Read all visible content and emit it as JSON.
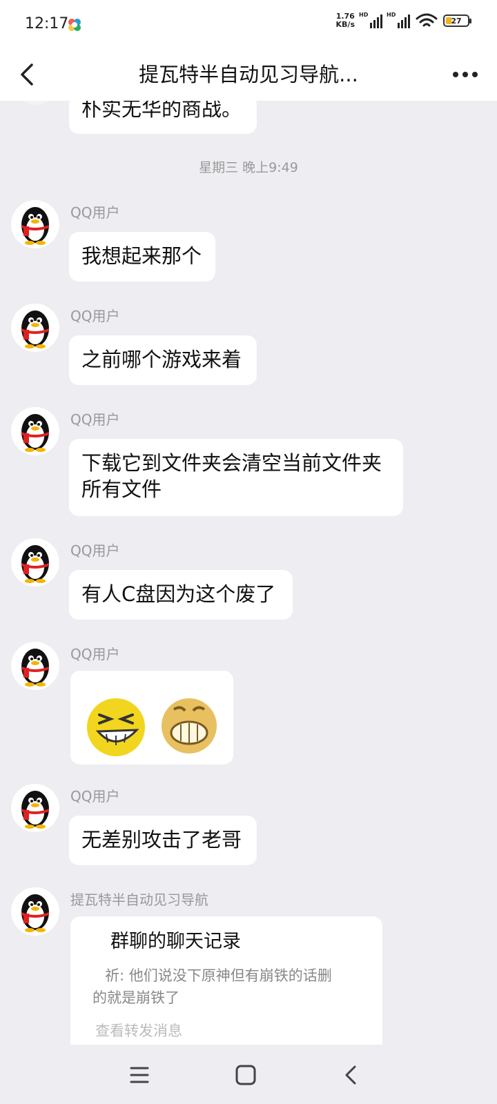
{
  "status_bar": {
    "time": "12:17",
    "net_speed_value": "1.76",
    "net_speed_unit": "KB/s",
    "signal_label_1": "HD",
    "signal_label_2": "HD",
    "battery": "27",
    "battery_level_percent": 27
  },
  "header": {
    "title": "提瓦特半自动见习导航..."
  },
  "chat": {
    "partial_message": "朴实无华的商战。",
    "time_divider": "星期三 晚上9:49",
    "messages": [
      {
        "sender": "QQ用户",
        "text": "我想起来那个"
      },
      {
        "sender": "QQ用户",
        "text": "之前哪个游戏来着"
      },
      {
        "sender": "QQ用户",
        "line1": "下载它到文件夹会清空当前文件夹",
        "line2": "所有文件"
      },
      {
        "sender": "QQ用户",
        "text": "有人C盘因为这个废了"
      },
      {
        "sender": "QQ用户",
        "stickers": [
          "laughing-face-emoji",
          "grinning-face-emoji"
        ]
      },
      {
        "sender": "QQ用户",
        "text": "无差别攻击了老哥"
      },
      {
        "sender": "提瓦特半自动见习导航",
        "card_title": "群聊的聊天记录",
        "card_preview_line1": "祈: 他们说没下原神但有崩铁的话删",
        "card_preview_line2": "的就是崩铁了",
        "card_footer": "查看转发消息"
      }
    ]
  },
  "colors": {
    "background": "#EDEDF2",
    "bubble": "#FFFFFF",
    "meta_text": "#999999",
    "battery_fill": "#F2B41C"
  },
  "icons": {
    "back": "chevron-left-icon",
    "more": "more-dots-icon",
    "nav_menu": "menu-icon",
    "nav_home": "home-square-icon",
    "nav_back": "nav-back-icon"
  }
}
